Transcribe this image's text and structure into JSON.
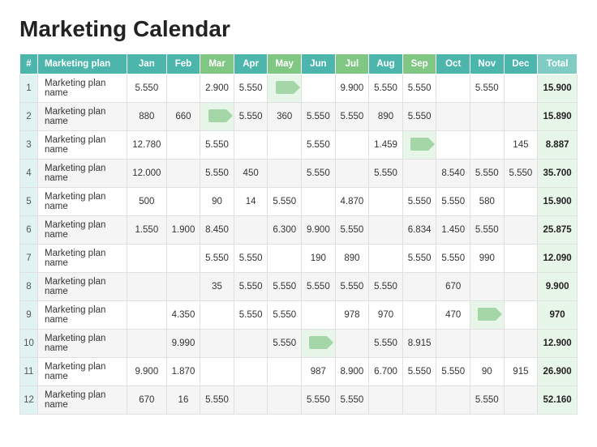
{
  "title": "Marketing Calendar",
  "table": {
    "headers": [
      "#",
      "Marketing plan",
      "Jan",
      "Feb",
      "Mar",
      "Apr",
      "May",
      "Jun",
      "Jul",
      "Aug",
      "Sep",
      "Oct",
      "Nov",
      "Dec",
      "Total"
    ],
    "rows": [
      {
        "num": "1",
        "name": "Marketing plan name",
        "Jan": "5.550",
        "Feb": "",
        "Mar": "2.900",
        "Apr": "5.550",
        "May": "arrow",
        "Jun": "",
        "Jul": "9.900",
        "Aug": "5.550",
        "Sep": "5.550",
        "Oct": "",
        "Nov": "5.550",
        "Dec": "",
        "Total": "15.900"
      },
      {
        "num": "2",
        "name": "Marketing plan name",
        "Jan": "880",
        "Feb": "660",
        "Mar": "arrow",
        "Apr": "5.550",
        "May": "360",
        "Jun": "5.550",
        "Jul": "5.550",
        "Aug": "890",
        "Sep": "5.550",
        "Oct": "",
        "Nov": "",
        "Dec": "",
        "Total": "15.890"
      },
      {
        "num": "3",
        "name": "Marketing plan name",
        "Jan": "12.780",
        "Feb": "",
        "Mar": "5.550",
        "Apr": "",
        "May": "",
        "Jun": "5.550",
        "Jul": "",
        "Aug": "1.459",
        "Sep": "arrow",
        "Oct": "",
        "Nov": "",
        "Dec": "145",
        "Total": "8.887"
      },
      {
        "num": "4",
        "name": "Marketing plan name",
        "Jan": "12.000",
        "Feb": "",
        "Mar": "5.550",
        "Apr": "450",
        "May": "",
        "Jun": "5.550",
        "Jul": "",
        "Aug": "5.550",
        "Sep": "",
        "Oct": "8.540",
        "Nov": "5.550",
        "Dec": "5.550",
        "Total": "35.700"
      },
      {
        "num": "5",
        "name": "Marketing plan name",
        "Jan": "500",
        "Feb": "",
        "Mar": "90",
        "Apr": "14",
        "May": "5.550",
        "Jun": "",
        "Jul": "4.870",
        "Aug": "",
        "Sep": "5.550",
        "Oct": "5.550",
        "Nov": "580",
        "Dec": "",
        "Total": "15.900"
      },
      {
        "num": "6",
        "name": "Marketing plan name",
        "Jan": "1.550",
        "Feb": "1.900",
        "Mar": "8.450",
        "Apr": "",
        "May": "6.300",
        "Jun": "9.900",
        "Jul": "5.550",
        "Aug": "",
        "Sep": "6.834",
        "Oct": "1.450",
        "Nov": "5.550",
        "Dec": "",
        "Total": "25.875"
      },
      {
        "num": "7",
        "name": "Marketing plan name",
        "Jan": "",
        "Feb": "",
        "Mar": "5.550",
        "Apr": "5.550",
        "May": "",
        "Jun": "190",
        "Jul": "890",
        "Aug": "",
        "Sep": "5.550",
        "Oct": "5.550",
        "Nov": "990",
        "Dec": "",
        "Total": "12.090"
      },
      {
        "num": "8",
        "name": "Marketing plan name",
        "Jan": "",
        "Feb": "",
        "Mar": "35",
        "Apr": "5.550",
        "May": "5.550",
        "Jun": "5.550",
        "Jul": "5.550",
        "Aug": "5.550",
        "Sep": "",
        "Oct": "670",
        "Nov": "",
        "Dec": "",
        "Total": "9.900"
      },
      {
        "num": "9",
        "name": "Marketing plan name",
        "Jan": "",
        "Feb": "4.350",
        "Mar": "",
        "Apr": "5.550",
        "May": "5.550",
        "Jun": "",
        "Jul": "978",
        "Aug": "970",
        "Sep": "",
        "Oct": "470",
        "Nov": "arrow",
        "Dec": "",
        "Total": "970"
      },
      {
        "num": "10",
        "name": "Marketing plan name",
        "Jan": "",
        "Feb": "9.990",
        "Mar": "",
        "Apr": "",
        "May": "5.550",
        "Jun": "arrow",
        "Jul": "",
        "Aug": "5.550",
        "Sep": "8.915",
        "Oct": "",
        "Nov": "",
        "Dec": "",
        "Total": "12.900"
      },
      {
        "num": "11",
        "name": "Marketing plan name",
        "Jan": "9.900",
        "Feb": "1.870",
        "Mar": "",
        "Apr": "",
        "May": "",
        "Jun": "987",
        "Jul": "8.900",
        "Aug": "6.700",
        "Sep": "5.550",
        "Oct": "5.550",
        "Nov": "90",
        "Dec": "915",
        "Total": "26.900"
      },
      {
        "num": "12",
        "name": "Marketing plan name",
        "Jan": "670",
        "Feb": "16",
        "Mar": "5.550",
        "Apr": "",
        "May": "",
        "Jun": "5.550",
        "Jul": "5.550",
        "Aug": "",
        "Sep": "",
        "Oct": "",
        "Nov": "5.550",
        "Dec": "",
        "Total": "52.160"
      }
    ]
  }
}
